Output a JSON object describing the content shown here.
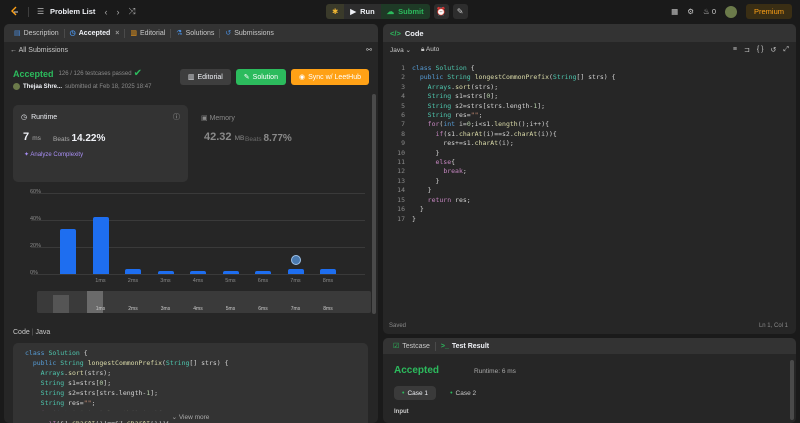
{
  "topbar": {
    "problem_list": "Problem List",
    "run": "Run",
    "submit": "Submit",
    "coins": "0",
    "premium": "Premium"
  },
  "left": {
    "tabs": [
      {
        "label": "Description",
        "icon": "document-icon"
      },
      {
        "label": "Accepted",
        "icon": "clock-icon"
      },
      {
        "label": "Editorial",
        "icon": "book-icon"
      },
      {
        "label": "Solutions",
        "icon": "flask-icon"
      },
      {
        "label": "Submissions",
        "icon": "history-icon"
      }
    ],
    "back": "All Submissions",
    "status": "Accepted",
    "passed": "126 / 126 testcases passed",
    "user": "Thejaa Shre...",
    "submitted": "submitted at Feb 18, 2025 18:47",
    "editorial_btn": "Editorial",
    "solution_btn": "Solution",
    "sync_btn": "Sync w/ LeetHub",
    "runtime": {
      "title": "Runtime",
      "value": "7",
      "unit": "ms",
      "beats_label": "Beats",
      "beats": "14.22%",
      "analyze": "Analyze Complexity"
    },
    "memory": {
      "title": "Memory",
      "value": "42.32",
      "unit": "MB",
      "beats_label": "Beats",
      "beats": "8.77%"
    },
    "code_label": "Code",
    "code_lang": "Java",
    "view_more": "View more"
  },
  "chart_data": {
    "type": "bar",
    "categories": [
      "",
      "1ms",
      "2ms",
      "3ms",
      "4ms",
      "5ms",
      "6ms",
      "7ms",
      "8ms"
    ],
    "values": [
      33,
      42,
      3.5,
      2.5,
      2.5,
      2.5,
      2.5,
      3.5,
      3.5
    ],
    "ylabels": [
      "60%",
      "40%",
      "20%",
      "0%"
    ],
    "ylim": [
      0,
      60
    ],
    "highlight": "7ms",
    "color": "#1e6ef0"
  },
  "right": {
    "code_title": "Code",
    "lang": "Java",
    "auto": "Auto",
    "saved": "Saved",
    "cursor": "Ln 1, Col 1",
    "testcase_tab": "Testcase",
    "result_tab": "Test Result",
    "result_status": "Accepted",
    "result_runtime": "Runtime: 6 ms",
    "case1": "Case 1",
    "case2": "Case 2",
    "input_label": "Input"
  }
}
